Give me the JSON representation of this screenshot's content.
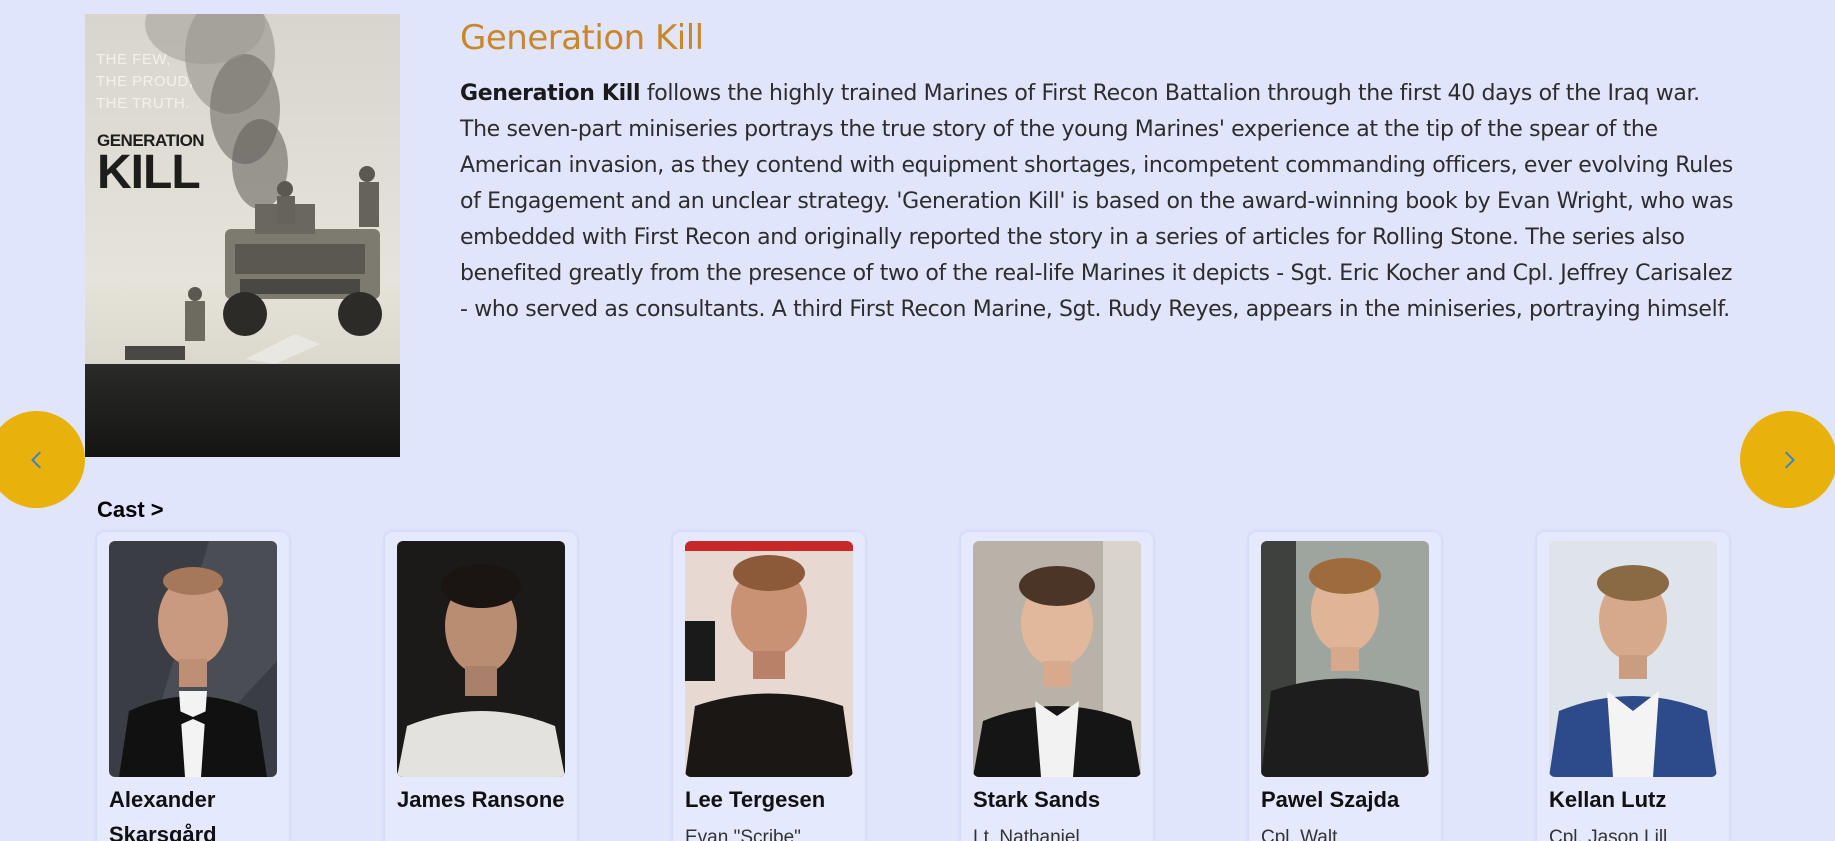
{
  "show": {
    "title": "Generation Kill",
    "description_lead": "Generation Kill",
    "description_body": " follows the highly trained Marines of First Recon Battalion through the first 40 days of the Iraq war. The seven-part miniseries portrays the true story of the young Marines' experience at the tip of the spear of the American invasion, as they contend with equipment shortages, incompetent commanding officers, ever evolving Rules of Engagement and an unclear strategy. 'Generation Kill' is based on the award-winning book by Evan Wright, who was embedded with First Recon and originally reported the story in a series of articles for Rolling Stone. The series also benefited greatly from the presence of two of the real-life Marines it depicts - Sgt. Eric Kocher and Cpl. Jeffrey Carisalez - who served as consultants. A third First Recon Marine, Sgt. Rudy Reyes, appears in the miniseries, portraying himself.",
    "poster": {
      "tagline": "THE FEW,\nTHE PROUD,\nTHE TRUTH.",
      "brand_line1": "GENERATION",
      "brand_line2": "KILL"
    }
  },
  "nav": {
    "prev_icon": "chevron-left-icon",
    "next_icon": "chevron-right-icon",
    "button_color": "#e8b10c",
    "icon_color": "#3a86c8"
  },
  "cast": {
    "heading": "Cast >",
    "members": [
      {
        "name": "Alexander Skarsgård",
        "role": ""
      },
      {
        "name": "James Ransone",
        "role": ""
      },
      {
        "name": "Lee Tergesen",
        "role": "Evan \"Scribe\""
      },
      {
        "name": "Stark Sands",
        "role": "Lt. Nathaniel"
      },
      {
        "name": "Pawel Szajda",
        "role": "Cpl. Walt"
      },
      {
        "name": "Kellan Lutz",
        "role": "Cpl. Jason Lill"
      }
    ]
  },
  "colors": {
    "background": "#e0e5fc",
    "title": "#c8882a",
    "accent": "#e8b10c"
  }
}
